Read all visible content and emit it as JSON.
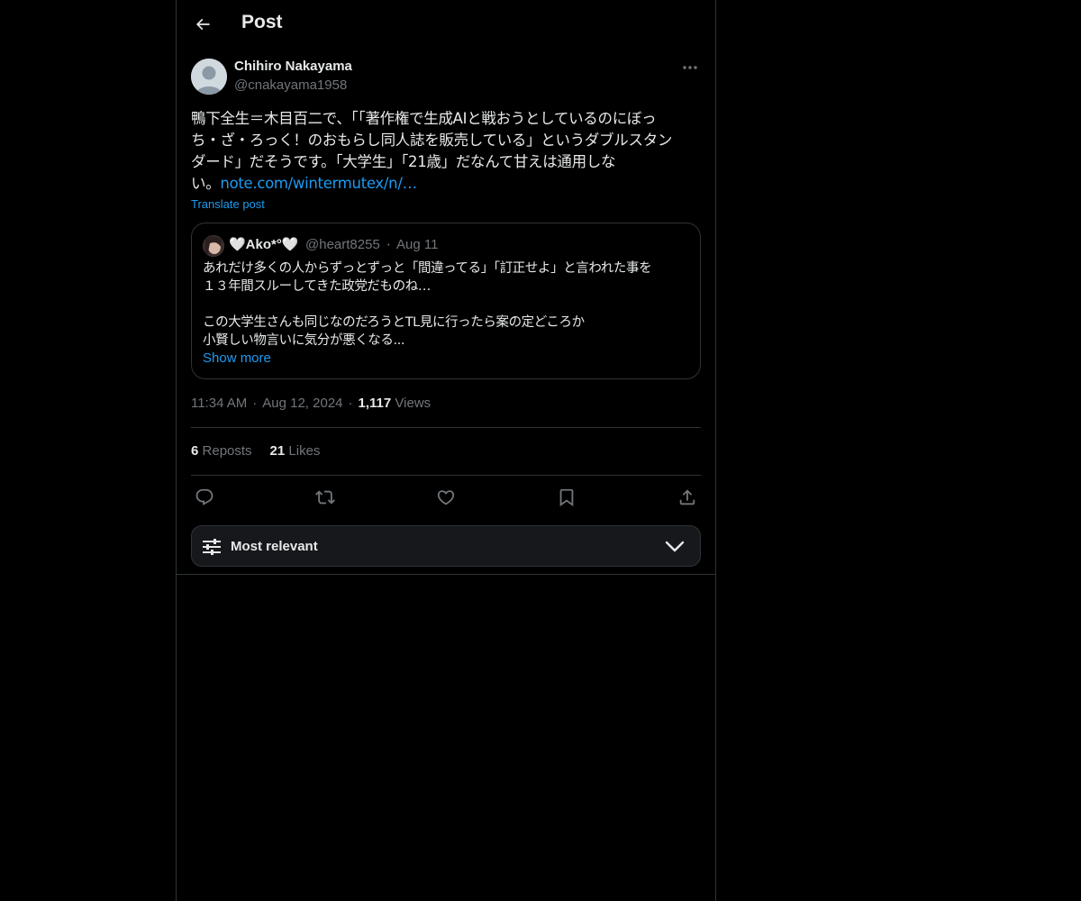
{
  "header": {
    "title": "Post"
  },
  "author": {
    "name": "Chihiro Nakayama",
    "handle": "@cnakayama1958"
  },
  "post": {
    "text_lines": [
      "鴨下全生＝木目百二で、「「著作権で生成AIと戦おうとしているのにぼっ",
      "ち・ざ・ろっく！のおもらし同人誌を販売している」というダブルスタン",
      "ダード」だそうです。「大学生」「21歳」だなんて甘えは通用しな"
    ],
    "last_line_prefix": "い。",
    "link": "note.com/wintermutex/n/…",
    "translate": "Translate post"
  },
  "quote": {
    "name": "🤍Ako*°🤍",
    "handle": "@heart8255",
    "separator": "·",
    "date": "Aug 11",
    "lines": [
      "あれだけ多くの人からずっとずっと「間違ってる」「訂正せよ」と言われた事を",
      "１３年間スルーしてきた政党だものね…",
      "",
      "この大学生さんも同じなのだろうとTL見に行ったら案の定どころか",
      "小賢しい物言いに気分が悪くなる..."
    ],
    "show_more": "Show more"
  },
  "meta": {
    "time": "11:34 AM",
    "sep1": "·",
    "date": "Aug 12, 2024",
    "sep2": "·",
    "views_count": "1,117",
    "views_label": "Views"
  },
  "stats": {
    "reposts_count": "6",
    "reposts_label": "Reposts",
    "likes_count": "21",
    "likes_label": "Likes"
  },
  "actions": [
    "reply-icon",
    "repost-icon",
    "like-icon",
    "bookmark-icon",
    "share-icon"
  ],
  "sort": {
    "label": "Most relevant"
  },
  "colors": {
    "background": "#000000",
    "text": "#e7e9ea",
    "muted": "#71767b",
    "link": "#1d9bf0",
    "border": "#2f3336"
  }
}
